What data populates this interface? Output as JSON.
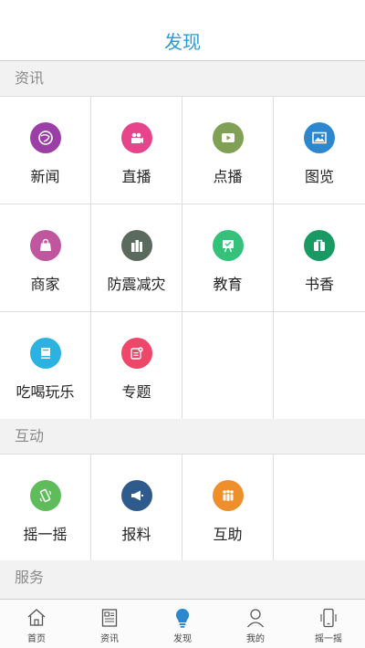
{
  "header": {
    "title": "发现"
  },
  "sections": {
    "news": {
      "label": "资讯",
      "items": [
        {
          "label": "新闻",
          "icon": "globe-icon",
          "color": "#9b3fa6"
        },
        {
          "label": "直播",
          "icon": "video-camera-icon",
          "color": "#e8448b"
        },
        {
          "label": "点播",
          "icon": "play-icon",
          "color": "#7fa055"
        },
        {
          "label": "图览",
          "icon": "image-icon",
          "color": "#2d87cf"
        },
        {
          "label": "商家",
          "icon": "shopping-bag-icon",
          "color": "#c0569e"
        },
        {
          "label": "防震减灾",
          "icon": "buildings-icon",
          "color": "#5a6a5c"
        },
        {
          "label": "教育",
          "icon": "blackboard-icon",
          "color": "#34c27b"
        },
        {
          "label": "书香",
          "icon": "book-icon",
          "color": "#1a9a63"
        },
        {
          "label": "吃喝玩乐",
          "icon": "notebook-icon",
          "color": "#2bb2e0"
        },
        {
          "label": "专题",
          "icon": "document-icon",
          "color": "#f0466a"
        }
      ]
    },
    "interaction": {
      "label": "互动",
      "items": [
        {
          "label": "摇一摇",
          "icon": "shake-phone-icon",
          "color": "#5ebc5a"
        },
        {
          "label": "报料",
          "icon": "megaphone-icon",
          "color": "#2f5b8c"
        },
        {
          "label": "互助",
          "icon": "people-icon",
          "color": "#ee8f2c"
        }
      ]
    },
    "services": {
      "label": "服务"
    }
  },
  "tabbar": {
    "items": [
      {
        "label": "首页",
        "icon": "home-icon"
      },
      {
        "label": "资讯",
        "icon": "news-icon"
      },
      {
        "label": "发现",
        "icon": "lightbulb-icon",
        "active": true
      },
      {
        "label": "我的",
        "icon": "person-icon"
      },
      {
        "label": "摇一摇",
        "icon": "phone-icon"
      }
    ]
  },
  "colors": {
    "accent": "#2a9bd6",
    "active_tab": "#2d87cf"
  }
}
